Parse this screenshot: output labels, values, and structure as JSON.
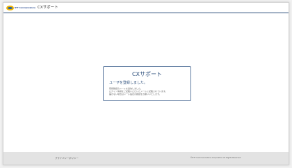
{
  "header": {
    "logo_text": "NTT Communications",
    "app_title": "CXサポート"
  },
  "card": {
    "title": "CXサポート",
    "heading": "ユーザを登録しました。",
    "lines": [
      "登録確認のメールを送信しました。",
      "ログイン情報をご記載いただいたメールに記載されています。",
      "届かない場合はメール設定の確認をお願いいたします。"
    ]
  },
  "footer": {
    "privacy_label": "プライバシーポリシー",
    "copyright": "©NTT Communications Corporation All Rights Reserved."
  },
  "colors": {
    "accent": "#2b4f7c",
    "footer_bg": "#e3e3e3",
    "logo_yellow": "#f0b400",
    "logo_blue": "#1b5fb4"
  }
}
